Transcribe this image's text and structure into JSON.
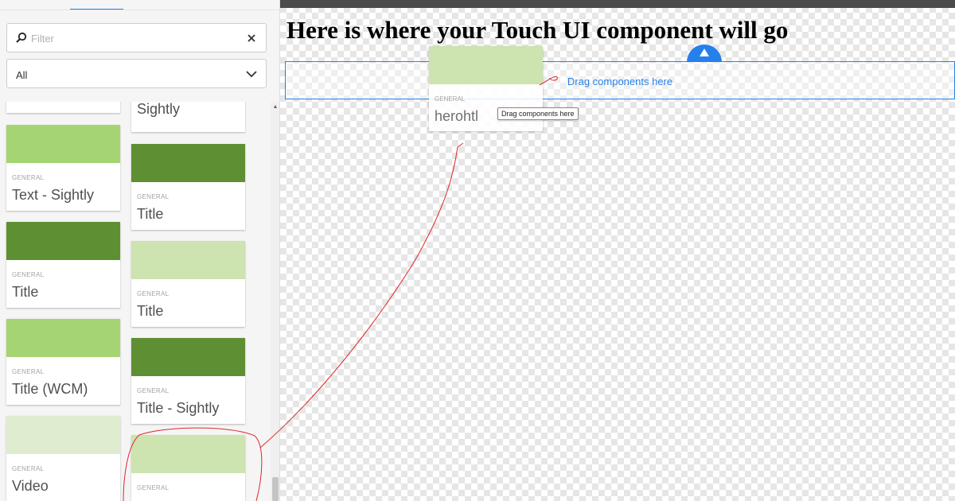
{
  "sidebar": {
    "search": {
      "placeholder": "Filter",
      "value": ""
    },
    "group_select": {
      "value": "All"
    },
    "components": [
      {
        "category": "GENERAL",
        "label": "Text - Sightly",
        "color": "#a5d573"
      },
      {
        "category": "GENERAL",
        "label": "Title",
        "color": "#5f8f33"
      },
      {
        "category": "GENERAL",
        "label": "Title (WCM)",
        "color": "#a5d573"
      },
      {
        "category": "GENERAL",
        "label": "Video",
        "color": "#e0ecd0"
      },
      {
        "category": "",
        "label": "Sightly",
        "color": "#ffffff"
      },
      {
        "category": "GENERAL",
        "label": "Title",
        "color": "#5f8f33"
      },
      {
        "category": "GENERAL",
        "label": "Title",
        "color": "#cde3b0"
      },
      {
        "category": "GENERAL",
        "label": "Title - Sightly",
        "color": "#5f8f33"
      },
      {
        "category": "GENERAL",
        "label": "",
        "color": "#cde3b0"
      }
    ]
  },
  "canvas": {
    "heading": "Here is where your Touch UI component will go",
    "drop_zone_label": "Drag components here",
    "dragged_component": {
      "category": "GENERAL",
      "label": "herohtl"
    },
    "tooltip": "Drag components here"
  },
  "colors": {
    "accent": "#2680eb",
    "annotation": "#e0262a"
  }
}
